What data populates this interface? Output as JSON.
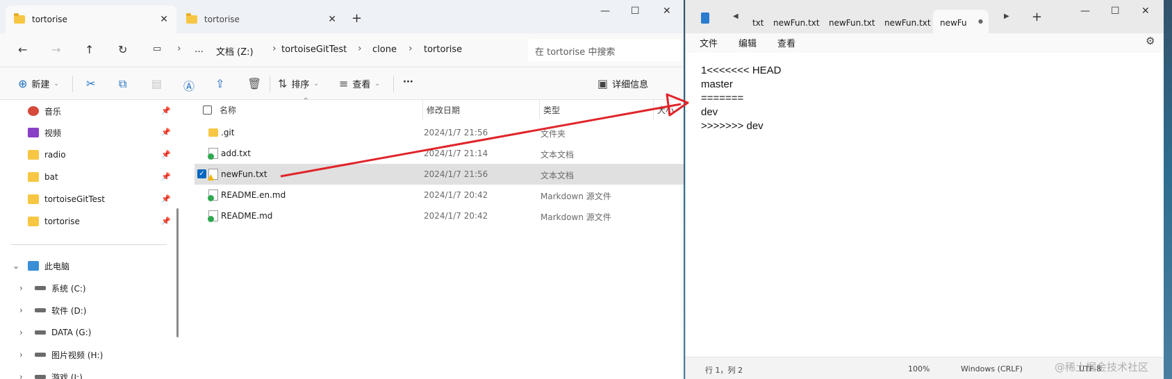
{
  "explorer": {
    "tabs": [
      {
        "label": "tortorise",
        "close": "✕"
      },
      {
        "label": "tortorise",
        "close": "✕"
      }
    ],
    "new_tab": "+",
    "window_controls": {
      "minimize": "—",
      "maximize": "☐",
      "close": "✕"
    },
    "nav": {
      "back": "←",
      "forward": "→",
      "up": "↑",
      "refresh": "↻",
      "more": "…"
    },
    "breadcrumb": [
      "文档 (Z:)",
      "tortoiseGitTest",
      "clone",
      "tortorise"
    ],
    "search_placeholder": "在 tortorise 中搜索",
    "toolbar": {
      "new_label": "新建",
      "sort_label": "排序",
      "view_label": "查看",
      "more": "···",
      "details_label": "详细信息"
    },
    "sidebar": {
      "quick_access": [
        {
          "label": "音乐",
          "color": "#d4493a"
        },
        {
          "label": "视频",
          "color": "#8a3fc7"
        },
        {
          "label": "radio",
          "color": "#f7c744"
        },
        {
          "label": "bat",
          "color": "#f7c744"
        },
        {
          "label": "tortoiseGitTest",
          "color": "#f7c744"
        },
        {
          "label": "tortorise",
          "color": "#f7c744"
        }
      ],
      "this_pc": "此电脑",
      "drives": [
        "系统 (C:)",
        "软件 (D:)",
        "DATA (G:)",
        "图片视频 (H:)",
        "游戏 (I:)"
      ]
    },
    "columns": {
      "name": "名称",
      "date": "修改日期",
      "type": "类型",
      "size": "大小"
    },
    "files": [
      {
        "name": ".git",
        "date": "2024/1/7 21:56",
        "type": "文件夹",
        "icon": "folder-icon"
      },
      {
        "name": "add.txt",
        "date": "2024/1/7 21:14",
        "type": "文本文档",
        "icon": "git-ok-icon"
      },
      {
        "name": "newFun.txt",
        "date": "2024/1/7 21:56",
        "type": "文本文档",
        "icon": "git-conflict-icon"
      },
      {
        "name": "README.en.md",
        "date": "2024/1/7 20:42",
        "type": "Markdown 源文件",
        "icon": "git-ok-icon"
      },
      {
        "name": "README.md",
        "date": "2024/1/7 20:42",
        "type": "Markdown 源文件",
        "icon": "git-ok-icon"
      }
    ],
    "selected_index": 2
  },
  "notepad": {
    "tabs": [
      "txt",
      "newFun.txt",
      "newFun.txt",
      "newFun.txt",
      "newFu"
    ],
    "active_tab_dot": "●",
    "new_tab": "+",
    "window_controls": {
      "minimize": "—",
      "maximize": "☐",
      "close": "✕"
    },
    "menu": [
      "文件",
      "编辑",
      "查看"
    ],
    "content_lines": [
      "1<<<<<<< HEAD",
      "master",
      "=======",
      "dev",
      ">>>>>>> dev"
    ],
    "status": {
      "position": "行 1，列 2",
      "zoom": "100%",
      "line_ending": "Windows (CRLF)",
      "encoding": "UTF-8"
    }
  },
  "watermark": "@稀土掘金技术社区",
  "colors": {
    "arrow": "#e0242a",
    "accent": "#0067c0"
  }
}
